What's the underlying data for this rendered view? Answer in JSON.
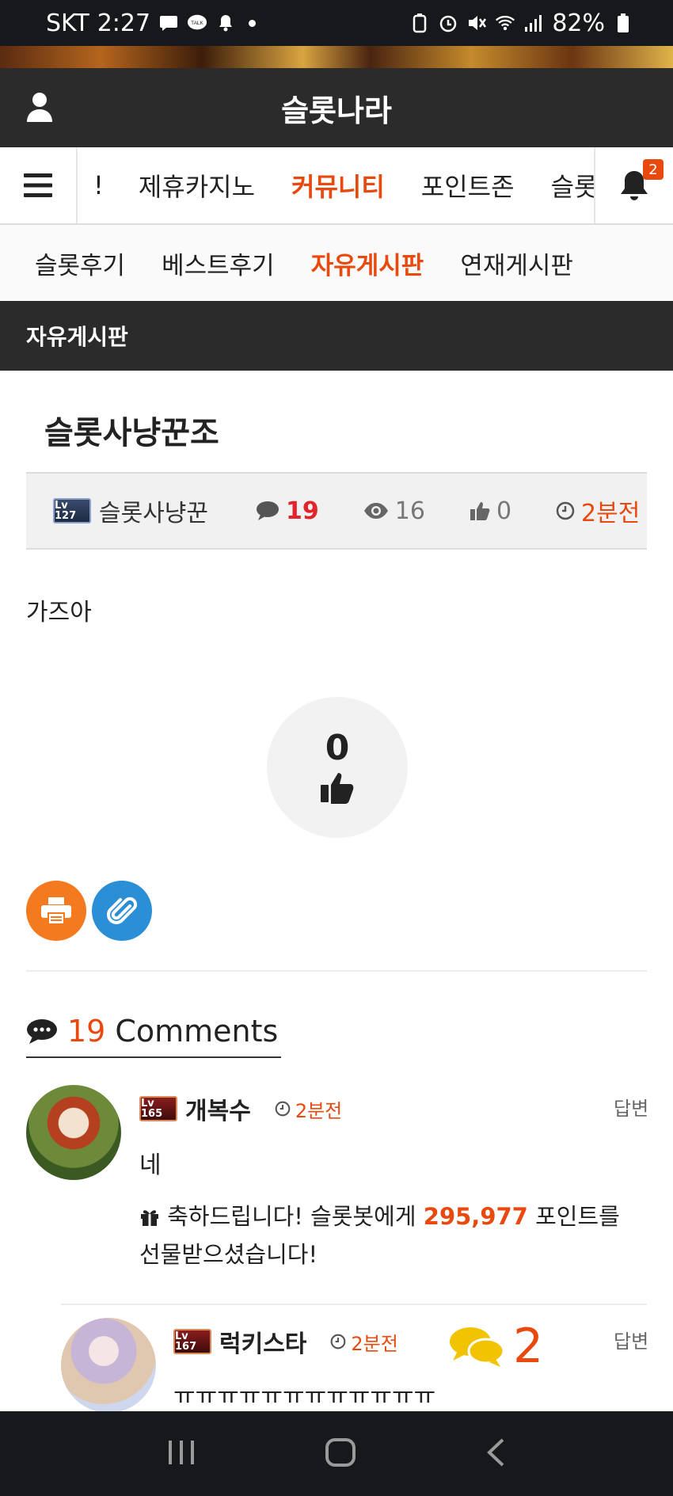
{
  "status_bar": {
    "carrier": "SKT",
    "time": "2:27",
    "battery": "82%",
    "talk_label": "TALK"
  },
  "header": {
    "title": "슬롯나라"
  },
  "main_nav": {
    "items": [
      {
        "label": "!"
      },
      {
        "label": "제휴카지노"
      },
      {
        "label": "커뮤니티"
      },
      {
        "label": "포인트존"
      },
      {
        "label": "슬롯"
      }
    ],
    "active_index": 2,
    "notification_count": "2"
  },
  "sub_nav": {
    "items": [
      {
        "label": "슬롯후기"
      },
      {
        "label": "베스트후기"
      },
      {
        "label": "자유게시판"
      },
      {
        "label": "연재게시판"
      }
    ],
    "active_index": 2
  },
  "section": {
    "title": "자유게시판"
  },
  "post": {
    "title": "슬롯사냥꾼조",
    "author": "슬롯사냥꾼",
    "author_level": "Lv 127",
    "comment_count": "19",
    "view_count": "16",
    "like_count": "0",
    "time": "2분전",
    "body": "가즈아",
    "recommend_count": "0"
  },
  "comments": {
    "count": "19",
    "label": "Comments",
    "reply_label": "답변",
    "items": [
      {
        "name": "개복수",
        "level": "Lv 165",
        "time": "2분전",
        "text": "네",
        "gift_prefix": "축하드립니다! 슬롯봇에게",
        "gift_points": "295,977",
        "gift_suffix": "포인트를 선물받으셨습니다!"
      },
      {
        "name": "럭키스타",
        "level": "Lv 167",
        "time": "2분전",
        "text": "ㅠㅠㅠㅠㅠㅠㅠㅠㅠㅠㅠㅠ",
        "reply_count": "2"
      }
    ]
  },
  "colors": {
    "accent": "#e8490f",
    "header_bg": "#2b2b2b",
    "print_button": "#f47a20",
    "link_button": "#2b8fd6",
    "chat_bubble": "#f2c300"
  }
}
